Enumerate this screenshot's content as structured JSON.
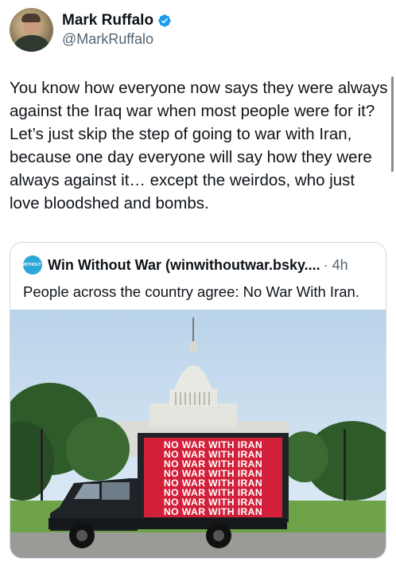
{
  "author": {
    "display_name": "Mark Ruffalo",
    "handle": "@MarkRuffalo"
  },
  "tweet": {
    "text": "You know how everyone now says they were always against the Iraq war when most people were for it? Let’s just skip the step of going to war with Iran, because one day everyone will say how they were always against it… except the weirdos, who just love bloodshed and bombs."
  },
  "quote": {
    "avatar_text": "WIN WITHOUT WAR",
    "name": "Win Without War (winwithoutwar.bsky....",
    "time": "· 4h",
    "text": "People across the country agree: No War With Iran.",
    "billboard_lines": [
      "NO WAR WITH IRAN",
      "NO WAR WITH IRAN",
      "NO WAR WITH IRAN",
      "NO WAR WITH IRAN",
      "NO WAR WITH IRAN",
      "NO WAR WITH IRAN",
      "NO WAR WITH IRAN",
      "NO WAR WITH IRAN"
    ]
  },
  "colors": {
    "verified": "#1d9bf0",
    "billboard": "#d2203a",
    "truck": "#1f2327"
  }
}
